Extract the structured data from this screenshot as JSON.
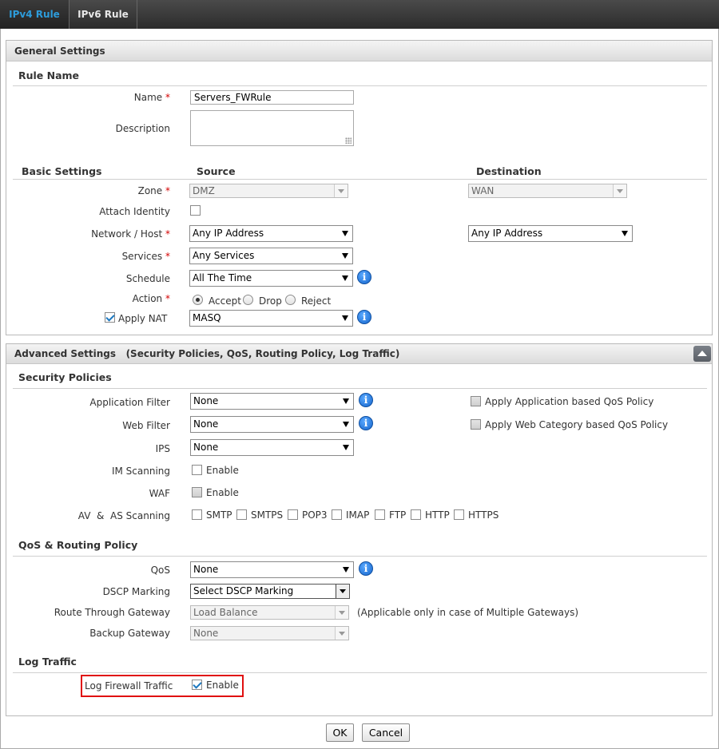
{
  "tabs": [
    {
      "label": "IPv4 Rule",
      "active": true
    },
    {
      "label": "IPv6 Rule",
      "active": false
    }
  ],
  "colors": {
    "active_tab": "#2d9cdb",
    "required": "#d40000",
    "highlight": "#e01010",
    "info_icon": "#1666cc"
  },
  "general": {
    "title": "General Settings",
    "rule_name_heading": "Rule Name",
    "name_label": "Name",
    "name_value": "Servers_FWRule",
    "description_label": "Description",
    "description_value": "",
    "basic_heading": "Basic Settings",
    "source_heading": "Source",
    "destination_heading": "Destination",
    "zone_label": "Zone",
    "zone_source": "DMZ",
    "zone_destination": "WAN",
    "attach_identity_label": "Attach Identity",
    "attach_identity_checked": false,
    "network_host_label": "Network / Host",
    "network_source": "Any IP Address",
    "network_destination": "Any IP Address",
    "services_label": "Services",
    "services_value": "Any Services",
    "schedule_label": "Schedule",
    "schedule_value": "All The Time",
    "action_label": "Action",
    "action_options": [
      "Accept",
      "Drop",
      "Reject"
    ],
    "action_selected": "Accept",
    "apply_nat_label": "Apply NAT",
    "apply_nat_checked": true,
    "nat_value": "MASQ",
    "required_mark": "*"
  },
  "advanced": {
    "title": "Advanced Settings",
    "title_detail": "(Security Policies, QoS, Routing Policy, Log Traffic)",
    "security_heading": "Security Policies",
    "app_filter_label": "Application Filter",
    "app_filter_value": "None",
    "app_qos_label": "Apply Application based QoS Policy",
    "web_filter_label": "Web Filter",
    "web_filter_value": "None",
    "web_qos_label": "Apply Web Category based QoS Policy",
    "ips_label": "IPS",
    "ips_value": "None",
    "im_label": "IM Scanning",
    "im_enable": "Enable",
    "waf_label": "WAF",
    "waf_enable": "Enable",
    "av_label": "AV  &  AS Scanning",
    "av_protocols": [
      "SMTP",
      "SMTPS",
      "POP3",
      "IMAP",
      "FTP",
      "HTTP",
      "HTTPS"
    ],
    "qos_heading": "QoS & Routing Policy",
    "qos_label": "QoS",
    "qos_value": "None",
    "dscp_label": "DSCP Marking",
    "dscp_value": "Select DSCP Marking",
    "route_label": "Route Through Gateway",
    "route_value": "Load Balance",
    "route_note": "(Applicable only in case of Multiple Gateways)",
    "backup_label": "Backup Gateway",
    "backup_value": "None",
    "log_heading": "Log Traffic",
    "log_fw_label": "Log Firewall Traffic",
    "log_fw_enable": "Enable",
    "log_fw_checked": true
  },
  "buttons": {
    "ok": "OK",
    "cancel": "Cancel"
  }
}
